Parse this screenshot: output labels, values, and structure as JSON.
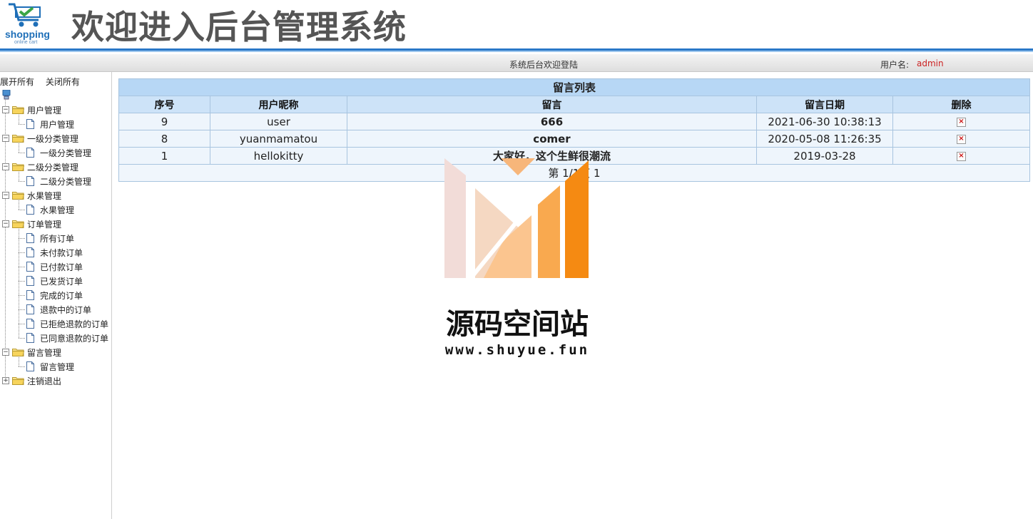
{
  "header": {
    "logo_text": "shopping",
    "logo_subtext": "online cart",
    "title": "欢迎进入后台管理系统"
  },
  "infobar": {
    "welcome": "系统后台欢迎登陆",
    "user_label": "用户名:",
    "user_name": "admin"
  },
  "sidebar": {
    "expand_all": "展开所有",
    "collapse_all": "关闭所有",
    "groups": [
      {
        "label": "用户管理",
        "toggle": "−",
        "items": [
          "用户管理"
        ]
      },
      {
        "label": "一级分类管理",
        "toggle": "−",
        "items": [
          "一级分类管理"
        ]
      },
      {
        "label": "二级分类管理",
        "toggle": "−",
        "items": [
          "二级分类管理"
        ]
      },
      {
        "label": "水果管理",
        "toggle": "−",
        "items": [
          "水果管理"
        ]
      },
      {
        "label": "订单管理",
        "toggle": "−",
        "items": [
          "所有订单",
          "未付款订单",
          "已付款订单",
          "已发货订单",
          "完成的订单",
          "退款中的订单",
          "已拒绝退款的订单",
          "已同意退款的订单"
        ]
      },
      {
        "label": "留言管理",
        "toggle": "−",
        "items": [
          "留言管理"
        ]
      },
      {
        "label": "注销退出",
        "toggle": "+",
        "items": []
      }
    ]
  },
  "table": {
    "caption": "留言列表",
    "columns": [
      "序号",
      "用户昵称",
      "留言",
      "留言日期",
      "删除"
    ],
    "rows": [
      {
        "id": "9",
        "nickname": "user",
        "message": "666",
        "date": "2021-06-30 10:38:13",
        "delete_icon": "x-icon"
      },
      {
        "id": "8",
        "nickname": "yuanmamatou",
        "message": "comer",
        "date": "2020-05-08 11:26:35",
        "delete_icon": "x-icon"
      },
      {
        "id": "1",
        "nickname": "hellokitty",
        "message": "大家好，这个生鲜很潮流",
        "date": "2019-03-28",
        "delete_icon": "x-icon"
      }
    ],
    "pager": "第 1/1页 1"
  },
  "watermark": {
    "name": "源码空间站",
    "url": "www.shuyue.fun"
  },
  "colors": {
    "accent_blue": "#2a78c8",
    "table_header": "#cde3f8",
    "message_red": "#c0181a",
    "watermark_orange": "#f5a040"
  }
}
